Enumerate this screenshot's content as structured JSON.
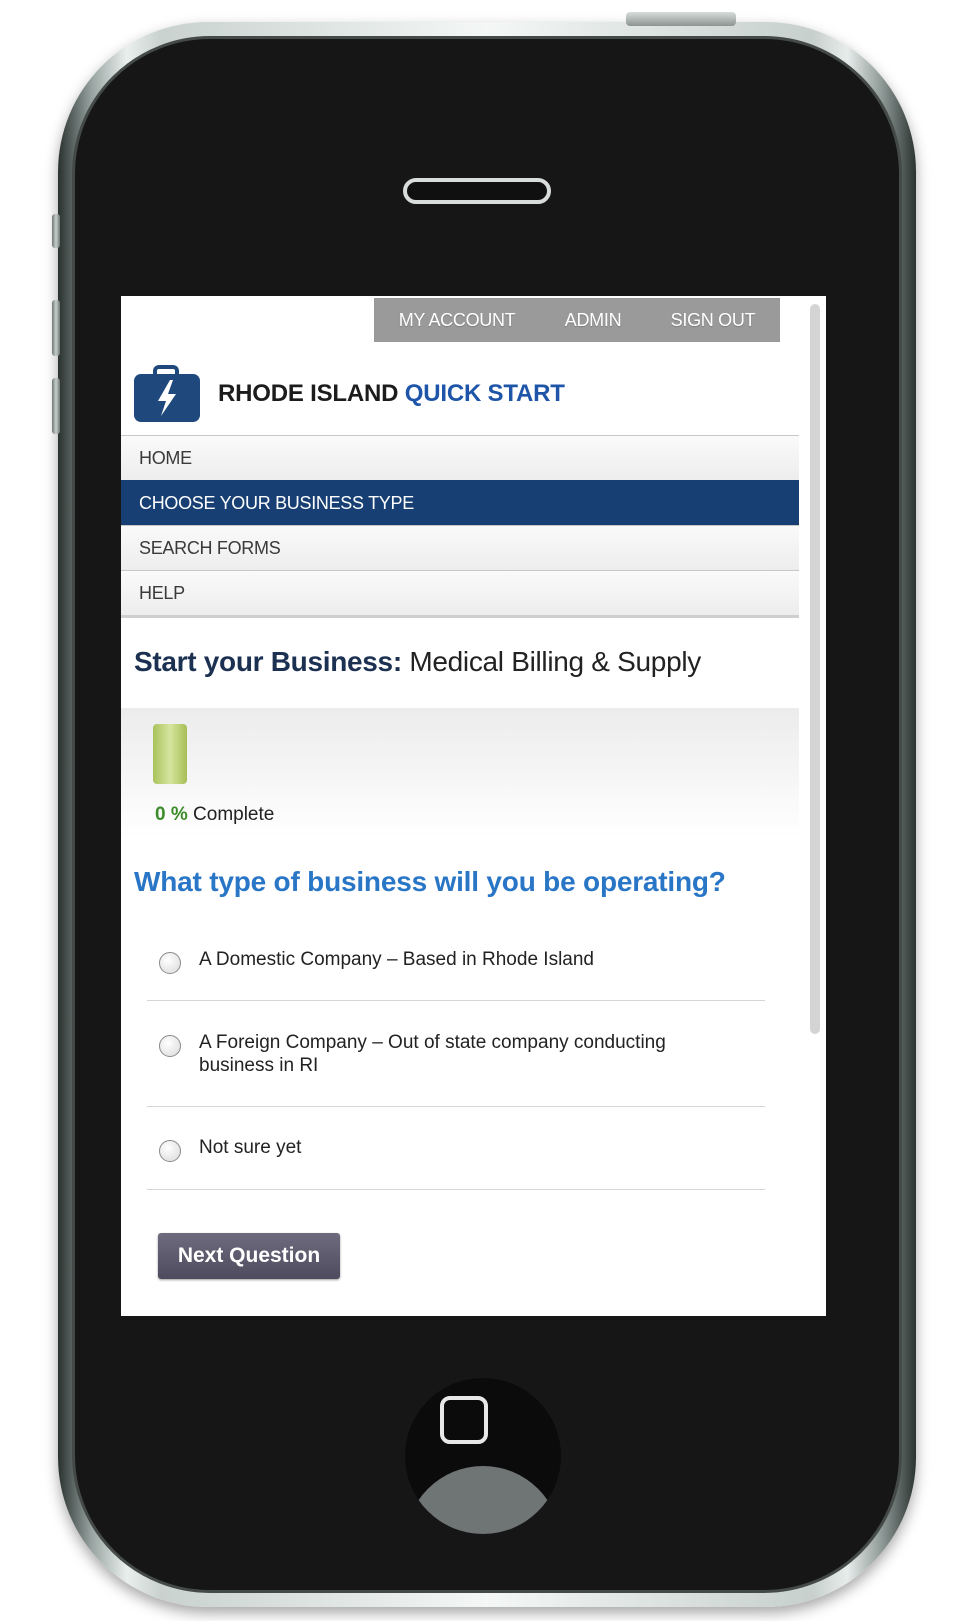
{
  "top_nav": {
    "items": [
      {
        "label": "MY ACCOUNT"
      },
      {
        "label": "ADMIN"
      },
      {
        "label": "SIGN OUT"
      }
    ]
  },
  "brand": {
    "name": "RHODE ISLAND",
    "accent": "QUICK START",
    "icon": "briefcase-lightning-icon"
  },
  "main_nav": {
    "items": [
      {
        "label": "HOME",
        "active": false
      },
      {
        "label": "CHOOSE YOUR BUSINESS TYPE",
        "active": true
      },
      {
        "label": "SEARCH FORMS",
        "active": false
      },
      {
        "label": "HELP",
        "active": false
      }
    ]
  },
  "page": {
    "title": "Start your Business:",
    "subtitle": "Medical Billing & Supply"
  },
  "progress": {
    "percent_text": "0 %",
    "label": "Complete",
    "fill_fraction": 1
  },
  "question": "What type of business will you be operating?",
  "options": [
    {
      "label": "A Domestic Company – Based in Rhode Island",
      "selected": false
    },
    {
      "label": "A Foreign Company – Out of state company conducting business in RI",
      "selected": false
    },
    {
      "label": "Not sure yet",
      "selected": false
    }
  ],
  "next_button": {
    "label": "Next Question"
  },
  "colors": {
    "nav_active": "#173f73",
    "brand_accent": "#1f55a8",
    "question": "#2a76c6",
    "top_nav_bg": "#9a9a9a"
  }
}
